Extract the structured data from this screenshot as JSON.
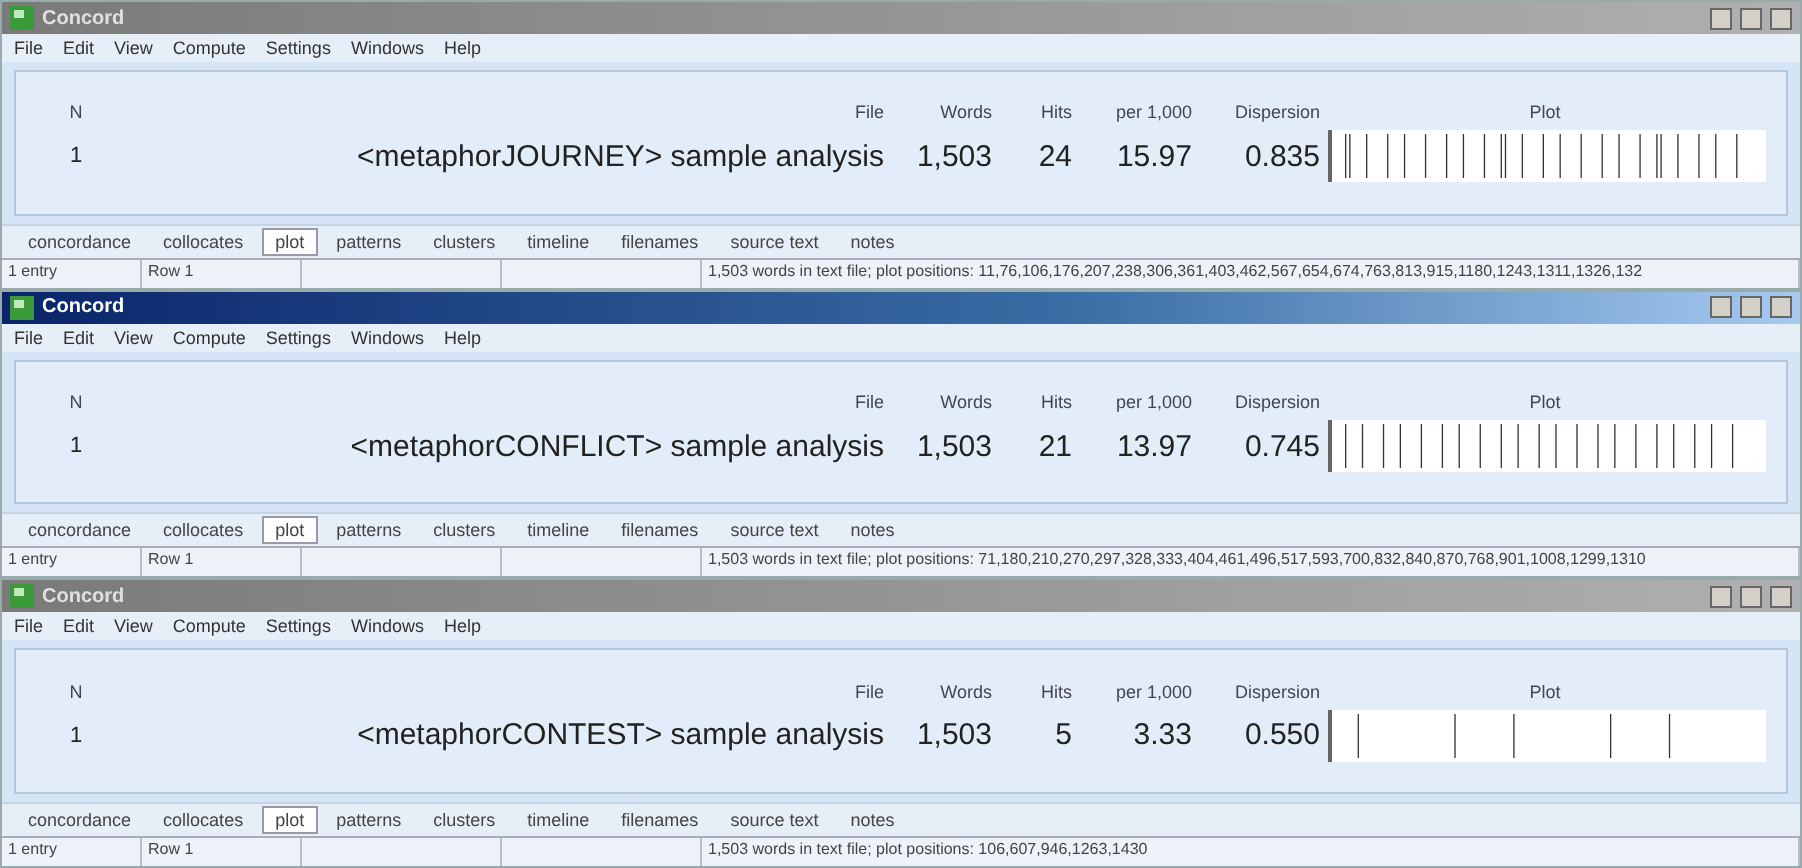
{
  "windows": [
    {
      "title": "Concord",
      "active": false,
      "menu": [
        "File",
        "Edit",
        "View",
        "Compute",
        "Settings",
        "Windows",
        "Help"
      ],
      "columns": [
        "N",
        "File",
        "Words",
        "Hits",
        "per 1,000",
        "Dispersion",
        "Plot"
      ],
      "row": {
        "n": "1",
        "file": "<metaphorJOURNEY> sample analysis",
        "words": "1,503",
        "hits": "24",
        "per_1000": "15.97",
        "dispersion": "0.835"
      },
      "tabs": [
        {
          "label": "concordance",
          "selected": false
        },
        {
          "label": "collocates",
          "selected": false
        },
        {
          "label": "plot",
          "selected": true
        },
        {
          "label": "patterns",
          "selected": false
        },
        {
          "label": "clusters",
          "selected": false
        },
        {
          "label": "timeline",
          "selected": false
        },
        {
          "label": "filenames",
          "selected": false
        },
        {
          "label": "source text",
          "selected": false
        },
        {
          "label": "notes",
          "selected": false
        }
      ],
      "status": [
        "1 entry",
        "Row 1",
        "1,503 words in text file; plot positions: 11,76,106,176,207,238,306,361,403,462,567,654,674,763,813,915,1180,1243,1311,1326,132"
      ]
    },
    {
      "title": "Concord",
      "active": true,
      "menu": [
        "File",
        "Edit",
        "View",
        "Compute",
        "Settings",
        "Windows",
        "Help"
      ],
      "columns": [
        "N",
        "File",
        "Words",
        "Hits",
        "per 1,000",
        "Dispersion",
        "Plot"
      ],
      "row": {
        "n": "1",
        "file": "<metaphorCONFLICT> sample analysis",
        "words": "1,503",
        "hits": "21",
        "per_1000": "13.97",
        "dispersion": "0.745"
      },
      "tabs": [
        {
          "label": "concordance",
          "selected": false
        },
        {
          "label": "collocates",
          "selected": false
        },
        {
          "label": "plot",
          "selected": true
        },
        {
          "label": "patterns",
          "selected": false
        },
        {
          "label": "clusters",
          "selected": false
        },
        {
          "label": "timeline",
          "selected": false
        },
        {
          "label": "filenames",
          "selected": false
        },
        {
          "label": "source text",
          "selected": false
        },
        {
          "label": "notes",
          "selected": false
        }
      ],
      "status": [
        "1 entry",
        "Row 1",
        "1,503 words in text file; plot positions: 71,180,210,270,297,328,333,404,461,496,517,593,700,832,840,870,768,901,1008,1299,1310"
      ]
    },
    {
      "title": "Concord",
      "active": false,
      "menu": [
        "File",
        "Edit",
        "View",
        "Compute",
        "Settings",
        "Windows",
        "Help"
      ],
      "columns": [
        "N",
        "File",
        "Words",
        "Hits",
        "per 1,000",
        "Dispersion",
        "Plot"
      ],
      "row": {
        "n": "1",
        "file": "<metaphorCONTEST> sample analysis",
        "words": "1,503",
        "hits": "5",
        "per_1000": "3.33",
        "dispersion": "0.550"
      },
      "tabs": [
        {
          "label": "concordance",
          "selected": false
        },
        {
          "label": "collocates",
          "selected": false
        },
        {
          "label": "plot",
          "selected": true
        },
        {
          "label": "patterns",
          "selected": false
        },
        {
          "label": "clusters",
          "selected": false
        },
        {
          "label": "timeline",
          "selected": false
        },
        {
          "label": "filenames",
          "selected": false
        },
        {
          "label": "source text",
          "selected": false
        },
        {
          "label": "notes",
          "selected": false
        }
      ],
      "status": [
        "1 entry",
        "Row 1",
        "1,503 words in text file; plot positions: 106,607,946,1263,1430"
      ]
    }
  ]
}
